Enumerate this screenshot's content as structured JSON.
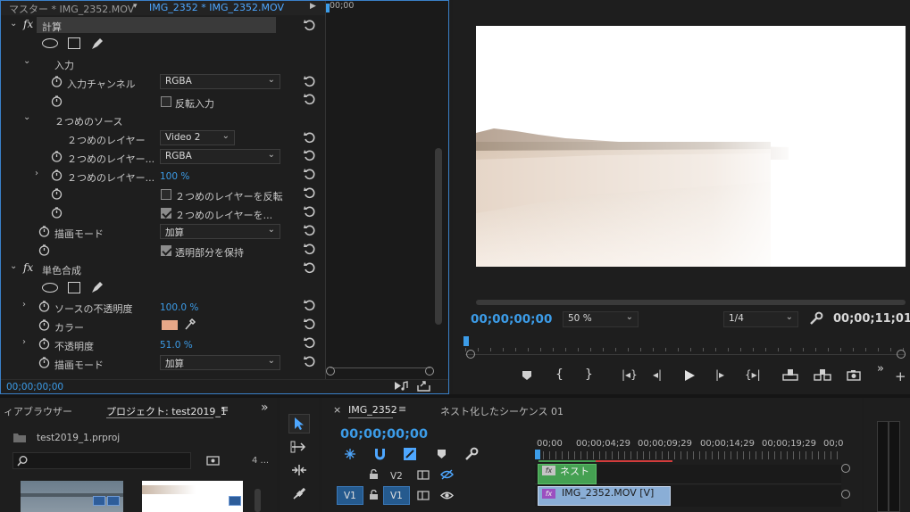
{
  "effect_controls": {
    "tabs": {
      "master": "マスター * IMG_2352.MOV",
      "active": "IMG_2352 * IMG_2352.MOV"
    },
    "timecode_start": "00;00",
    "compute": {
      "name": "計算",
      "input_section": "入力",
      "input_channel_label": "入力チャンネル",
      "input_channel_value": "RGBA",
      "invert_input_label": "反転入力",
      "second_source_section": "２つめのソース",
      "second_layer_label": "２つめのレイヤー",
      "second_layer_value": "Video 2",
      "second_layer_channel_label": "２つめのレイヤー...",
      "second_layer_channel_value": "RGBA",
      "second_layer_opacity_label": "２つめのレイヤー...",
      "second_layer_opacity_value": "100 %",
      "invert_second_label": "２つめのレイヤーを反転",
      "stretch_second_label": "２つめのレイヤーを...",
      "blend_mode_label": "描画モード",
      "blend_mode_value": "加算",
      "preserve_transparency_label": "透明部分を保持"
    },
    "solid_composite": {
      "name": "単色合成",
      "source_opacity_label": "ソースの不透明度",
      "source_opacity_value": "100.0 %",
      "color_label": "カラー",
      "color_swatch": "#e8a888",
      "opacity_label": "不透明度",
      "opacity_value": "51.0 %",
      "blend_mode_label": "描画モード",
      "blend_mode_value": "加算"
    },
    "footer_timecode": "00;00;00;00"
  },
  "program_monitor": {
    "timecode": "00;00;00;00",
    "zoom": "50 %",
    "resolution": "1/4",
    "duration": "00;00;11;01"
  },
  "project_panel": {
    "tab_media_browser": "ィアブラウザー",
    "tab_project": "プロジェクト: test2019_1",
    "project_file": "test2019_1.prproj",
    "items_count": "4 ..."
  },
  "timeline": {
    "sequence_tab": "IMG_2352",
    "nested_tab": "ネスト化したシーケンス 01",
    "timecode": "00;00;00;00",
    "ruler": [
      "00;00",
      "00;00;04;29",
      "00;00;09;29",
      "00;00;14;29",
      "00;00;19;29",
      "00;0"
    ],
    "tracks": {
      "v2": "V2",
      "v1_src": "V1",
      "v1": "V1"
    },
    "clips": {
      "nest": "ネスト",
      "main": "IMG_2352.MOV [V]"
    }
  },
  "colors": {
    "accent": "#3c9ce8",
    "nest_clip": "#45a052",
    "main_clip": "#8aaed6",
    "bg": "#1d1d1d"
  }
}
